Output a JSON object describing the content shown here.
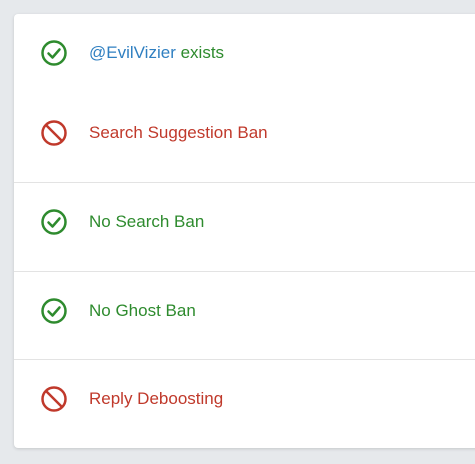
{
  "checks": [
    {
      "status": "pass",
      "handle": "@EvilVizier",
      "label": " exists",
      "icon": "check-circle-icon"
    },
    {
      "status": "fail",
      "label": "Search Suggestion Ban",
      "icon": "prohibited-icon"
    },
    {
      "status": "pass",
      "label": "No Search Ban",
      "icon": "check-circle-icon"
    },
    {
      "status": "pass",
      "label": "No Ghost Ban",
      "icon": "check-circle-icon"
    },
    {
      "status": "fail",
      "label": "Reply Deboosting",
      "icon": "prohibited-icon"
    }
  ],
  "colors": {
    "pass": "#2e8b2e",
    "fail": "#c0392b",
    "handle": "#2f7fc1"
  }
}
